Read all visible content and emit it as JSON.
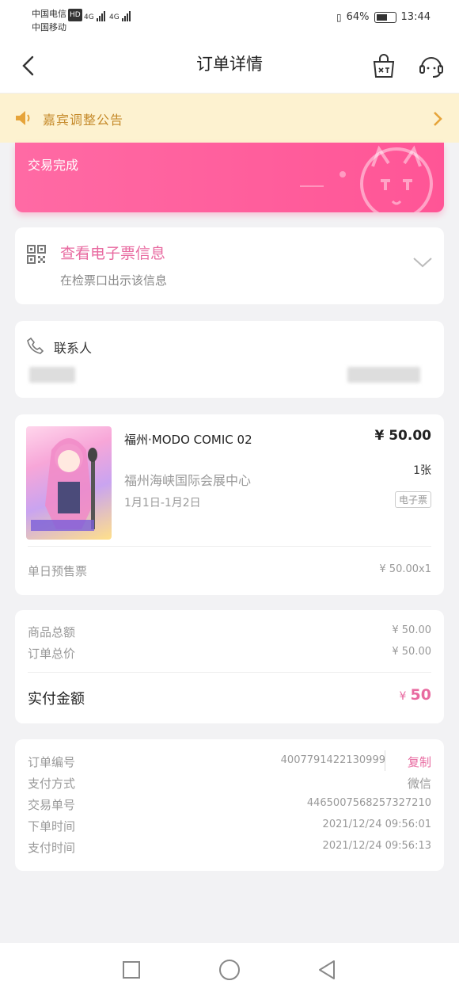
{
  "status_bar": {
    "carrier_1": "中国电信",
    "carrier_1_badge": "HD",
    "carrier_2": "中国移动",
    "network_1": "4G",
    "network_2": "4G",
    "battery_percent": "64%",
    "battery_level": 0.64,
    "time": "13:44"
  },
  "nav": {
    "title": "订单详情",
    "back_icon": "chevron-left-icon",
    "cart_icon": "shopping-bag-icon",
    "service_icon": "customer-service-icon"
  },
  "notice": {
    "text": "嘉宾调整公告",
    "icon": "speaker-icon"
  },
  "order_status": {
    "text": "交易完成",
    "accent": "#ff5a9a"
  },
  "eticket": {
    "title": "查看电子票信息",
    "subtitle": "在检票口出示该信息"
  },
  "contact": {
    "label": "联系人"
  },
  "item": {
    "name": "福州·MODO COMIC 02",
    "price": "¥ 50.00",
    "qty": "1张",
    "venue": "福州海峡国际会展中心",
    "date": "1月1日-1月2日",
    "ticket_type_tag": "电子票",
    "ticket_kind": "单日预售票",
    "unit_price": "¥ 50.00x1"
  },
  "summary": {
    "goods_total_label": "商品总额",
    "goods_total": "¥ 50.00",
    "order_total_label": "订单总价",
    "order_total": "¥ 50.00",
    "paid_label": "实付金额",
    "paid_currency": "¥",
    "paid_value": "50"
  },
  "order_info": {
    "order_no_label": "订单编号",
    "order_no": "4007791422130999",
    "copy_label": "复制",
    "pay_method_label": "支付方式",
    "pay_method": "微信",
    "trade_no_label": "交易单号",
    "trade_no": "4465007568257327210",
    "order_time_label": "下单时间",
    "order_time": "2021/12/24 09:56:01",
    "pay_time_label": "支付时间",
    "pay_time": "2021/12/24 09:56:13"
  }
}
